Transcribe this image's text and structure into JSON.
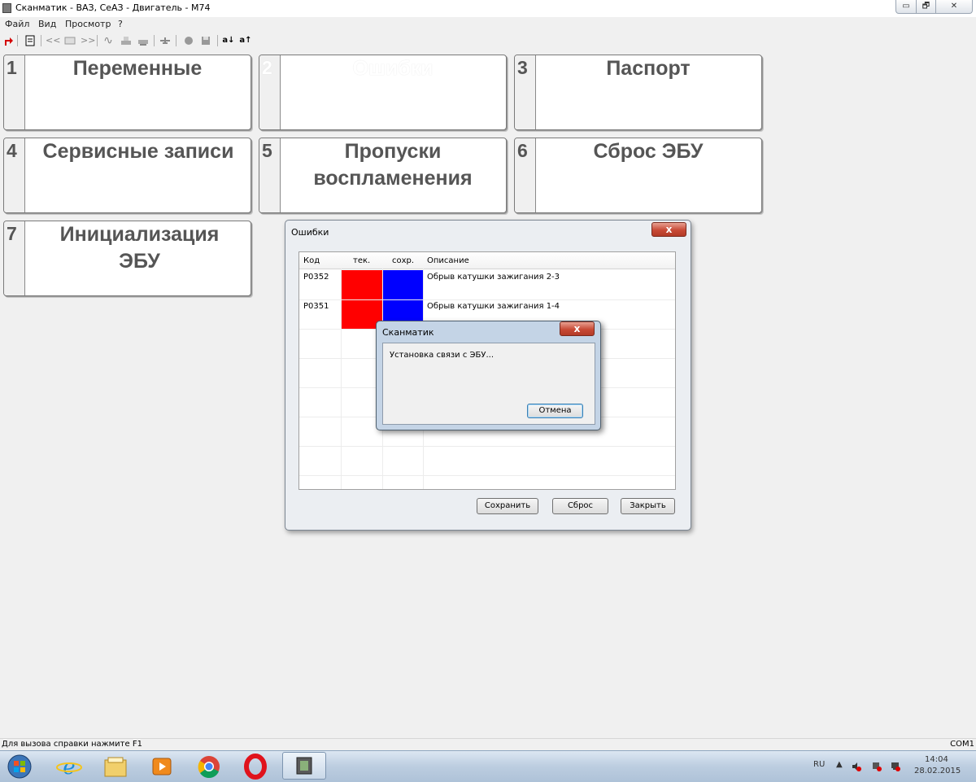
{
  "window": {
    "title": "Сканматик - ВАЗ, СеАЗ - Двигатель - М74",
    "minimize_glyph": "▭",
    "restore_glyph": "🗗",
    "close_glyph": "✕"
  },
  "menu": [
    "Файл",
    "Вид",
    "Просмотр",
    "?"
  ],
  "toolbar": {
    "icons": [
      "exit-arrow-icon",
      "report-icon",
      "rewind-icon",
      "list-icon",
      "forward-icon",
      "wave-icon",
      "print-icon",
      "printer-icon",
      "plane-icon",
      "record-icon",
      "save-icon",
      "font-down-icon",
      "font-up-icon"
    ],
    "prev_glyph": "<<",
    "next_glyph": ">>",
    "wave_glyph": "∿",
    "font_down_label": "a↓",
    "font_up_label": "a↑"
  },
  "tiles": [
    {
      "num": "1",
      "label": "Переменные",
      "enabled": true
    },
    {
      "num": "2",
      "label": "Ошибки",
      "enabled": false
    },
    {
      "num": "3",
      "label": "Паспорт",
      "enabled": true
    },
    {
      "num": "4",
      "label": "Сервисные записи",
      "enabled": true
    },
    {
      "num": "5",
      "label": "Пропуски воспламенения",
      "enabled": true
    },
    {
      "num": "6",
      "label": "Сброс ЭБУ",
      "enabled": true
    },
    {
      "num": "7",
      "label": "Инициализация ЭБУ",
      "enabled": true
    }
  ],
  "errors_dialog": {
    "title": "Ошибки",
    "close_glyph": "x",
    "columns": [
      "Код",
      "тек.",
      "сохр.",
      "Описание"
    ],
    "rows": [
      {
        "code": "P0352",
        "current_color": "#ff0000",
        "saved_color": "#0000ff",
        "description": "Обрыв катушки зажигания 2-3"
      },
      {
        "code": "P0351",
        "current_color": "#ff0000",
        "saved_color": "#0000ff",
        "description": "Обрыв катушки зажигания 1-4"
      }
    ],
    "buttons": {
      "save": "Сохранить",
      "reset": "Сброс",
      "close": "Закрыть"
    }
  },
  "connect_dialog": {
    "title": "Сканматик",
    "close_glyph": "x",
    "message": "Установка связи с ЭБУ...",
    "cancel": "Отмена"
  },
  "status": {
    "help": "Для вызова справки нажмите F1",
    "port": "COM1"
  },
  "taskbar": {
    "apps": [
      "windows-start-icon",
      "internet-explorer-icon",
      "file-explorer-icon",
      "media-player-icon",
      "chrome-icon",
      "opera-icon",
      "scanmatik-icon"
    ],
    "lang": "RU",
    "time": "14:04",
    "date": "28.02.2015"
  },
  "colors": {
    "error_current": "#ff0000",
    "error_saved": "#0000ff",
    "tile_text": "#555555"
  }
}
